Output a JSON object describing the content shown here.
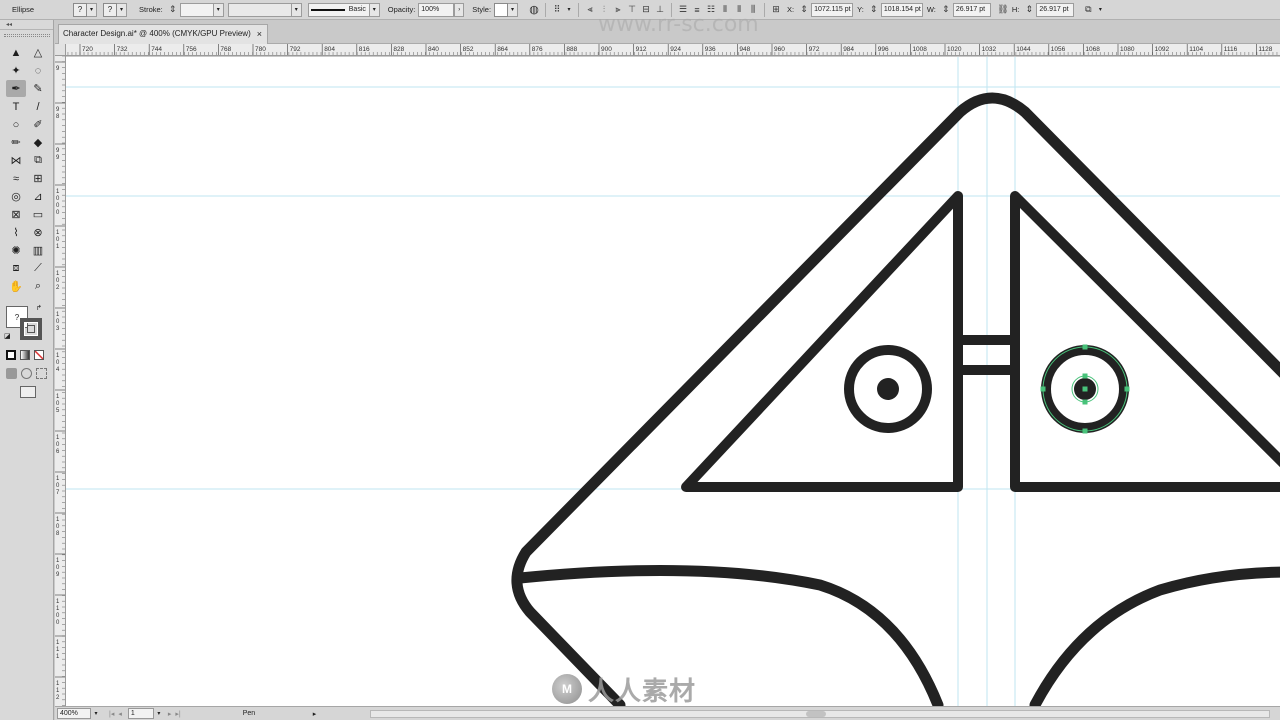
{
  "control_bar": {
    "selection_type": "Ellipse",
    "fill_swatch": "?",
    "stroke_swatch": "?",
    "stroke_label": "Stroke:",
    "stroke_value": "",
    "brush_name": "Basic",
    "opacity_label": "Opacity:",
    "opacity_value": "100%",
    "style_label": "Style:",
    "x_label": "X:",
    "x_value": "1072.115 pt",
    "y_label": "Y:",
    "y_value": "1018.154 pt",
    "w_label": "W:",
    "w_value": "26.917 pt",
    "h_label": "H:",
    "h_value": "26.917 pt"
  },
  "document": {
    "tab_title": "Character Design.ai* @ 400% (CMYK/GPU Preview)",
    "close_glyph": "×"
  },
  "rulers": {
    "h_labels": [
      "720",
      "732",
      "744",
      "756",
      "768",
      "780",
      "792",
      "804",
      "816",
      "828",
      "840",
      "852",
      "864",
      "876",
      "888",
      "900",
      "912",
      "924",
      "936",
      "948",
      "960",
      "972",
      "984",
      "996",
      "1008",
      "1020",
      "1032",
      "1044",
      "1056",
      "1068",
      "1080",
      "1092",
      "1104",
      "1116",
      "1128"
    ],
    "v_labels": [
      "9",
      "9 8",
      "9 9",
      "1 0 0 0",
      "1 0 1",
      "1 0 2",
      "1 0 3",
      "1 0 4",
      "1 0 5",
      "1 0 6",
      "1 0 7",
      "1 0 8",
      "1 0 9",
      "1 1 0 0",
      "1 1 1",
      "1 1 2"
    ]
  },
  "status_bar": {
    "zoom": "400%",
    "artboard": "1",
    "current_tool": "Pen"
  },
  "tools": [
    {
      "name": "selection-tool",
      "glyph": "▲"
    },
    {
      "name": "direct-selection-tool",
      "glyph": "△"
    },
    {
      "name": "magic-wand-tool",
      "glyph": "✦"
    },
    {
      "name": "lasso-tool",
      "glyph": "◌"
    },
    {
      "name": "pen-tool",
      "glyph": "✒"
    },
    {
      "name": "curvature-tool",
      "glyph": "✎"
    },
    {
      "name": "type-tool",
      "glyph": "T"
    },
    {
      "name": "line-segment-tool",
      "glyph": "/"
    },
    {
      "name": "ellipse-tool",
      "glyph": "○"
    },
    {
      "name": "paintbrush-tool",
      "glyph": "✐"
    },
    {
      "name": "pencil-tool",
      "glyph": "✏"
    },
    {
      "name": "eraser-tool",
      "glyph": "◆"
    },
    {
      "name": "reflect-tool",
      "glyph": "⋈"
    },
    {
      "name": "scale-tool",
      "glyph": "⧉"
    },
    {
      "name": "warp-tool",
      "glyph": "≈"
    },
    {
      "name": "free-transform-tool",
      "glyph": "⊞"
    },
    {
      "name": "shape-builder-tool",
      "glyph": "◎"
    },
    {
      "name": "perspective-grid-tool",
      "glyph": "⊿"
    },
    {
      "name": "mesh-tool",
      "glyph": "⊠"
    },
    {
      "name": "gradient-tool",
      "glyph": "▭"
    },
    {
      "name": "eyedropper-tool",
      "glyph": "⌇"
    },
    {
      "name": "blend-tool",
      "glyph": "⊗"
    },
    {
      "name": "symbol-sprayer-tool",
      "glyph": "✺"
    },
    {
      "name": "column-graph-tool",
      "glyph": "▥"
    },
    {
      "name": "artboard-tool",
      "glyph": "⧈"
    },
    {
      "name": "slice-tool",
      "glyph": "⟋"
    },
    {
      "name": "hand-tool",
      "glyph": "✋"
    },
    {
      "name": "zoom-tool",
      "glyph": "⌕"
    }
  ],
  "watermark": {
    "brand_text": "人人素材",
    "logo_glyph": "M",
    "url_text": "www.rr-sc.com"
  }
}
